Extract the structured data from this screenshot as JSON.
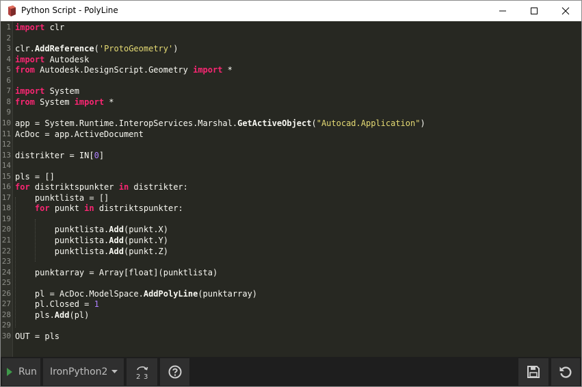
{
  "window": {
    "title": "Python Script - PolyLine",
    "icon": "python-script-icon",
    "controls": [
      "minimize-icon",
      "maximize-icon",
      "close-icon"
    ]
  },
  "editor": {
    "lines": [
      {
        "n": "1",
        "code": "import clr"
      },
      {
        "n": "2",
        "code": ""
      },
      {
        "n": "3",
        "code": "clr.AddReference('ProtoGeometry')"
      },
      {
        "n": "4",
        "code": "import Autodesk"
      },
      {
        "n": "5",
        "code": "from Autodesk.DesignScript.Geometry import *"
      },
      {
        "n": "6",
        "code": ""
      },
      {
        "n": "7",
        "code": "import System"
      },
      {
        "n": "8",
        "code": "from System import *"
      },
      {
        "n": "9",
        "code": ""
      },
      {
        "n": "10",
        "code": "app = System.Runtime.InteropServices.Marshal.GetActiveObject(\"Autocad.Application\")"
      },
      {
        "n": "11",
        "code": "AcDoc = app.ActiveDocument"
      },
      {
        "n": "12",
        "code": ""
      },
      {
        "n": "13",
        "code": "distrikter = IN[0]"
      },
      {
        "n": "14",
        "code": ""
      },
      {
        "n": "15",
        "code": "pls = []"
      },
      {
        "n": "16",
        "code": "for distriktspunkter in distrikter:"
      },
      {
        "n": "17",
        "code": "    punktlista = []"
      },
      {
        "n": "18",
        "code": "    for punkt in distriktspunkter:"
      },
      {
        "n": "19",
        "code": ""
      },
      {
        "n": "20",
        "code": "        punktlista.Add(punkt.X)"
      },
      {
        "n": "21",
        "code": "        punktlista.Add(punkt.Y)"
      },
      {
        "n": "22",
        "code": "        punktlista.Add(punkt.Z)"
      },
      {
        "n": "23",
        "code": ""
      },
      {
        "n": "24",
        "code": "    punktarray = Array[float](punktlista)"
      },
      {
        "n": "25",
        "code": ""
      },
      {
        "n": "26",
        "code": "    pl = AcDoc.ModelSpace.AddPolyLine(punktarray)"
      },
      {
        "n": "27",
        "code": "    pl.Closed = 1"
      },
      {
        "n": "28",
        "code": "    pls.Add(pl)"
      },
      {
        "n": "29",
        "code": ""
      },
      {
        "n": "30",
        "code": "OUT = pls"
      }
    ],
    "colors": {
      "background": "#272822",
      "keyword": "#f92672",
      "string": "#e6db74",
      "number": "#ae81ff",
      "text": "#f8f8f2",
      "line_number": "#8f908a"
    }
  },
  "toolbar": {
    "run_label": "Run",
    "run_icon": "play-icon",
    "engine_value": "IronPython2",
    "engine_caret_icon": "dropdown-caret-icon",
    "convert_icon": "convert-tabs-to-spaces-icon",
    "help_icon": "help-icon",
    "save_icon": "save-icon",
    "revert_icon": "revert-icon"
  }
}
